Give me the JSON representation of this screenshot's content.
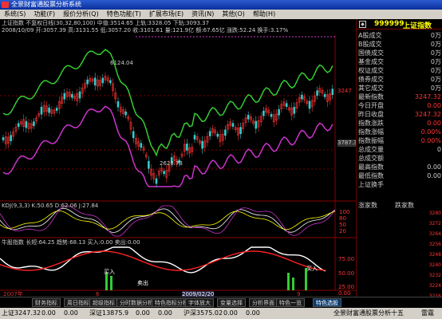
{
  "window": {
    "title": "全景财富通股票分析系统"
  },
  "menu": [
    "系统(S)",
    "功能(F)",
    "报价分析(Q)",
    "特色功能(T)",
    "扩展市场(E)",
    "资讯(N)",
    "其他(O)",
    "帮助(H)"
  ],
  "main_chart": {
    "caption": "上证指数 不复权日线(30,32,80,100) 中值:3514.65 上轨:3328.05 下轨:3093.37",
    "caption2": "2008/10/09 开:3057.39 高:3131.55 低:3057.20 收:3101.61 量:121.9亿 额:67.65亿 涨跌:52.24 换手:3.17%",
    "high_label": "6124.04",
    "low_label": "2628.73",
    "right_labels": [
      "3247",
      "3787.3"
    ],
    "price_tag": "3247.32",
    "colors": {
      "upper": "#33cc33",
      "lower": "#cc33cc",
      "up": "#ff3333",
      "down": "#33cccc"
    }
  },
  "kdj": {
    "caption": "KDJ(9,3,3) K:50.65 D:62.06 J:27.84",
    "right_labels": [
      "100",
      "80",
      "50",
      "20"
    ]
  },
  "ind2": {
    "caption": "牛股指数 长短:64.25 趋势:68.13 买入:0.00 卖出:0.00",
    "right_labels": [
      "75.00",
      "50.00",
      "25.00",
      "0.00"
    ],
    "buy_label": "买入",
    "sell_label": "卖出",
    "buy_label2": "买入"
  },
  "date_axis": [
    "2007年",
    "6",
    "2009/02/20",
    "9"
  ],
  "right_panel": {
    "code": "999999",
    "name": "上证指数",
    "rows": [
      {
        "label": "A股成交",
        "value": "0万"
      },
      {
        "label": "B股成交",
        "value": "0万"
      },
      {
        "label": "国债成交",
        "value": "0万"
      },
      {
        "label": "基金成交",
        "value": "0万"
      },
      {
        "label": "权证成交",
        "value": "0万"
      },
      {
        "label": "债券成交",
        "value": "0万"
      },
      {
        "label": "其它成交",
        "value": "0万"
      },
      {
        "label": "最新指数",
        "value": "3247.32"
      },
      {
        "label": "今日开盘",
        "value": "0.00"
      },
      {
        "label": "昨日收盘",
        "value": "3247.32"
      },
      {
        "label": "指数涨跌",
        "value": "0.00"
      },
      {
        "label": "指数涨幅",
        "value": "0.00%"
      },
      {
        "label": "指数振幅",
        "value": "0.00%"
      },
      {
        "label": "总成交量",
        "value": "0"
      },
      {
        "label": "总成交额",
        "value": ""
      },
      {
        "label": "最高指数",
        "value": "0.00"
      },
      {
        "label": "最低指数",
        "value": "0.00"
      },
      {
        "label": "上证换手",
        "value": ""
      }
    ],
    "up_count": "涨家数",
    "down_count": "跌家数",
    "tick_scale": [
      "3280",
      "3272",
      "3264",
      "3256",
      "3248",
      "3240",
      "3232",
      "3224",
      "3216"
    ]
  },
  "tabs": [
    "财务指标",
    "周日指标",
    "超级指标",
    "分时数据分析",
    "特色指标分析",
    "字体放大",
    "变量选择",
    "分析界面",
    "特色一览",
    "特色选股"
  ],
  "status": {
    "sh": "上证3247.32",
    "sh_chg": "0.00",
    "sh_pct": "0.00",
    "sz": "深证13875.9",
    "sz_chg": "0.00",
    "sz_pct": "0.00",
    "hs": "沪深3575.02",
    "hs_chg": "0.00",
    "hs_pct": "0.00",
    "info": "全景财富通股票分析十五",
    "extra": "雷霆"
  }
}
